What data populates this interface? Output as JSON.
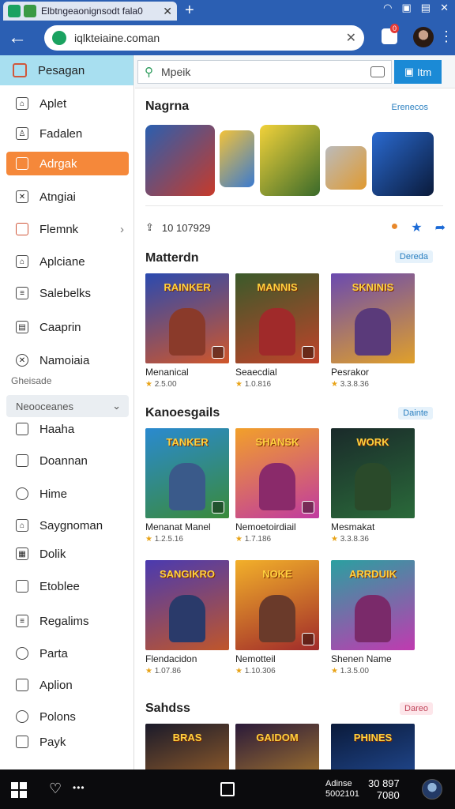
{
  "browser": {
    "tab_title": "Elbtngeaonignsodt fala0",
    "new_tab": "+",
    "url": "iqlkteiaine.coman",
    "extension_badge": "0"
  },
  "sidebar": {
    "header": "Pesagan",
    "items": [
      {
        "label": "Aplet",
        "icon": "home-icon"
      },
      {
        "label": "Fadalen",
        "icon": "profile-icon"
      },
      {
        "label": "Adrgak",
        "icon": "file-icon",
        "active": true
      },
      {
        "label": "Atngiai",
        "icon": "close-box-icon"
      },
      {
        "label": "Flemnk",
        "icon": "folder-icon",
        "chevron": true
      },
      {
        "label": "Aplciane",
        "icon": "home-icon"
      },
      {
        "label": "Salebelks",
        "icon": "list-icon"
      },
      {
        "label": "Caaprin",
        "icon": "document-icon"
      },
      {
        "label": "Namoiaia",
        "icon": "x-circle-icon"
      }
    ],
    "subtext": "Gheisade",
    "section": "Neooceanes",
    "items2": [
      {
        "label": "Haaha",
        "icon": "box-icon"
      },
      {
        "label": "Doannan",
        "icon": "window-icon"
      },
      {
        "label": "Hime",
        "icon": "clock-icon"
      },
      {
        "label": "Saygnoman",
        "icon": "home-icon"
      },
      {
        "label": "Dolik",
        "icon": "grid-icon"
      },
      {
        "label": "Etoblee",
        "icon": "calendar-icon"
      },
      {
        "label": "Regalims",
        "icon": "note-icon"
      },
      {
        "label": "Parta",
        "icon": "people-icon"
      },
      {
        "label": "Aplion",
        "icon": "shield-icon"
      },
      {
        "label": "Polons",
        "icon": "gear-icon"
      },
      {
        "label": "Payk",
        "icon": "badge-icon"
      }
    ]
  },
  "search": {
    "placeholder": "Mpeik",
    "button": "Itm"
  },
  "featured": {
    "title": "Nagrna",
    "link": "Erenecos",
    "rating_text": "10 107929"
  },
  "sections": [
    {
      "title": "Matterdn",
      "link": "Dereda",
      "cards": [
        {
          "art_text": "RAINKER",
          "name": "Menanical",
          "rating": "2.5.00"
        },
        {
          "art_text": "MANNIS",
          "name": "Seaecdial",
          "rating": "1.0.816"
        },
        {
          "art_text": "SKNINIS",
          "name": "Pesrakor",
          "rating": "3.3.8.36"
        }
      ]
    },
    {
      "title": "Kanoesgails",
      "link": "Dainte",
      "cards": [
        {
          "art_text": "TANKER",
          "name": "Menanat Manel",
          "rating": "1.2.5.16"
        },
        {
          "art_text": "SHANSK",
          "name": "Nemoetoirdiail",
          "rating": "1.7.186"
        },
        {
          "art_text": "WORK",
          "name": "Mesmakat",
          "rating": "3.3.8.36"
        }
      ]
    },
    {
      "title": "",
      "link": "",
      "cards": [
        {
          "art_text": "SANGIKRO",
          "name": "Flendacidon",
          "rating": "1.07.86"
        },
        {
          "art_text": "NOKE",
          "name": "Nemotteil",
          "rating": "1.10.306"
        },
        {
          "art_text": "ARRDUIK",
          "name": "Shenen Name",
          "rating": "1.3.5.00"
        }
      ]
    },
    {
      "title": "Sahdss",
      "link": "Dareo",
      "cards": [
        {
          "art_text": "BRAS",
          "name": "",
          "rating": ""
        },
        {
          "art_text": "GAIDOM",
          "name": "",
          "rating": ""
        },
        {
          "art_text": "PHINES",
          "name": "",
          "rating": ""
        }
      ]
    }
  ],
  "taskbar": {
    "status_line1": "Adinse",
    "status_line2": "5002101",
    "time_line1": "30 897",
    "time_line2": "7080"
  },
  "colors": {
    "chrome_blue": "#2b5fb3",
    "active_orange": "#f5883a",
    "sidebar_header": "#a8dff0",
    "accent_blue": "#1b8ad6"
  }
}
